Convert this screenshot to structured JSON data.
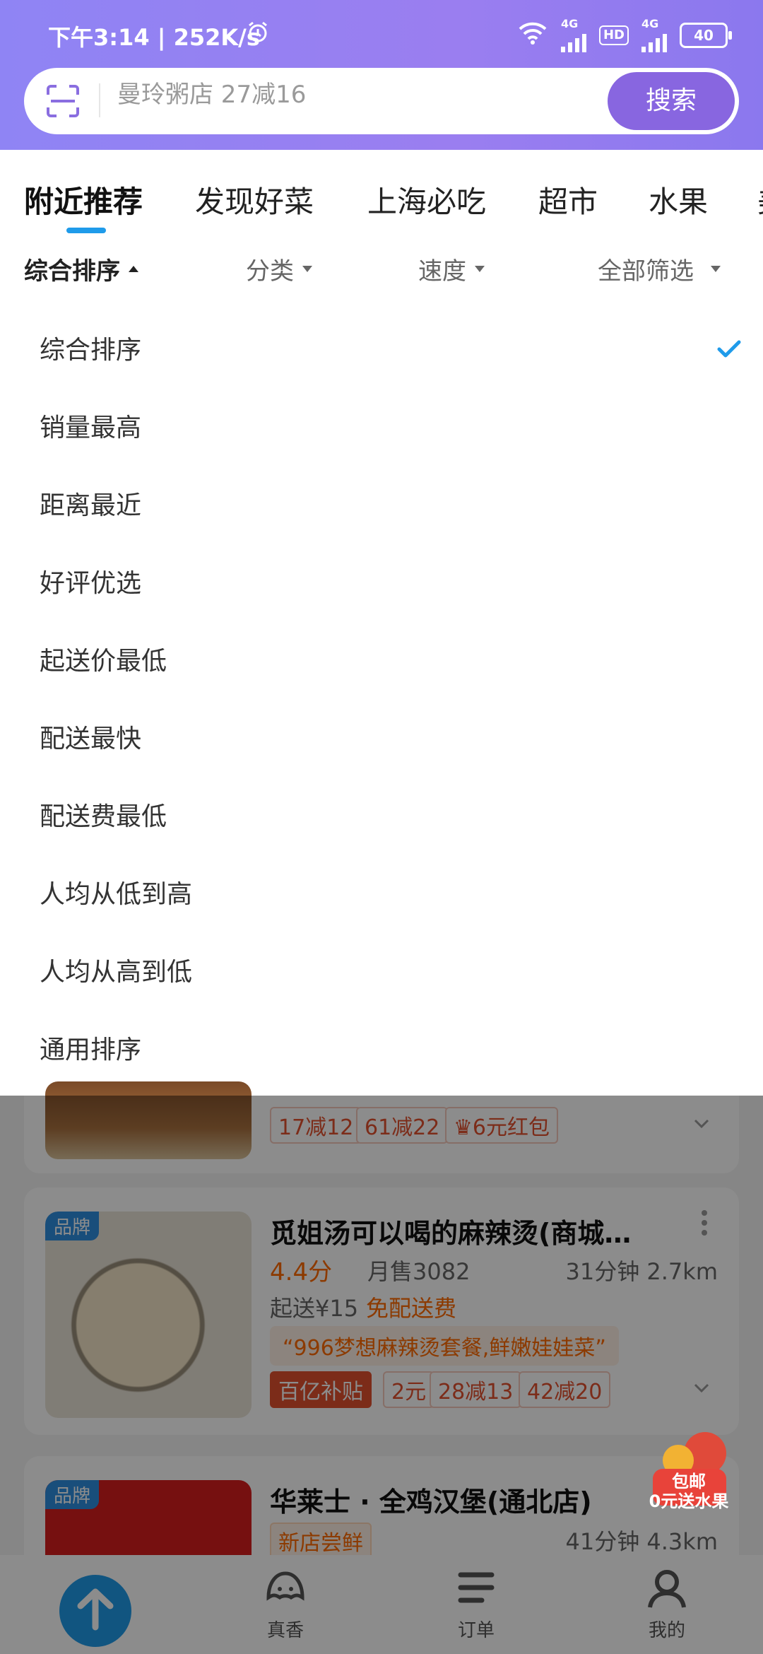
{
  "status_bar": {
    "time": "下午3:14 | 252K/s",
    "network_1": "4G",
    "hd": "HD",
    "network_2": "4G",
    "battery": "40"
  },
  "search": {
    "placeholder": "曼玲粥店 27减16",
    "button": "搜索"
  },
  "tabs": [
    "附近推荐",
    "发现好菜",
    "上海必吃",
    "超市",
    "水果",
    "美"
  ],
  "filters": {
    "sort": "综合排序",
    "category": "分类",
    "speed": "速度",
    "all_filter": "全部筛选"
  },
  "sort_options": [
    "综合排序",
    "销量最高",
    "距离最近",
    "好评优选",
    "起送价最低",
    "配送最快",
    "配送费最低",
    "人均从低到高",
    "人均从高到低",
    "通用排序"
  ],
  "selected_sort_index": 0,
  "cards": [
    {
      "tags": [
        "17减12",
        "61减22",
        "6元红包"
      ]
    },
    {
      "badge": "品牌",
      "name": "觅姐汤可以喝的麻辣烫(商城…",
      "rating": "4.4分",
      "sales": "月售3082",
      "eta": "31分钟 2.7km",
      "min_price": "起送¥15",
      "free_ship": "免配送费",
      "quote": "“996梦想麻辣烫套餐,鲜嫩娃娃菜”",
      "tags": [
        "百亿补贴",
        "2元",
        "28减13",
        "42减20"
      ]
    },
    {
      "badge": "品牌",
      "name": "华莱士 · 全鸡汉堡(通北店)",
      "new_tag": "新店尝鲜",
      "eta": "41分钟 4.3km"
    }
  ],
  "float_promo": {
    "line1": "包邮",
    "line2": "0元送水果"
  },
  "bottom_nav": [
    "真香",
    "订单",
    "我的"
  ],
  "colors": {
    "accent_purple": "#8866e0",
    "accent_blue": "#1f9bea",
    "orange": "#ff6a00"
  }
}
